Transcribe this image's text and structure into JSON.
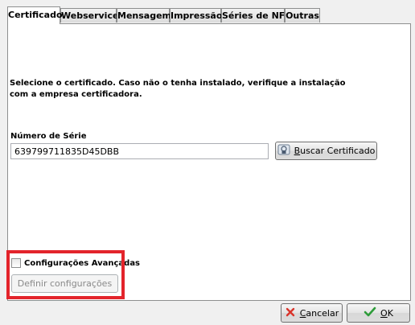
{
  "tabs": [
    {
      "label": "Certificado",
      "active": true
    },
    {
      "label": "Webservice",
      "active": false
    },
    {
      "label": "Mensagem",
      "active": false
    },
    {
      "label": "Impressão",
      "active": false
    },
    {
      "label": "Séries de NFe",
      "active": false
    },
    {
      "label": "Outras",
      "active": false
    }
  ],
  "certificate": {
    "instruction_line1": "Selecione o certificado. Caso não o tenha instalado, verifique a instalação",
    "instruction_line2": "com a empresa certificadora.",
    "serial_label": "Número de Série",
    "serial_value": "639799711835D45DBB",
    "search_button_prefix": "",
    "search_button_accel": "B",
    "search_button_rest": "uscar Certificado"
  },
  "advanced": {
    "checkbox_label": "Configurações Avançadas",
    "checked": false,
    "define_button_label": "Definir configurações"
  },
  "footer": {
    "cancel_accel": "C",
    "cancel_rest": "ancelar",
    "ok_accel": "O",
    "ok_rest": "K"
  },
  "colors": {
    "highlight": "#e3242b",
    "cancel_icon": "#d9342b",
    "ok_icon": "#2e9c3a"
  }
}
